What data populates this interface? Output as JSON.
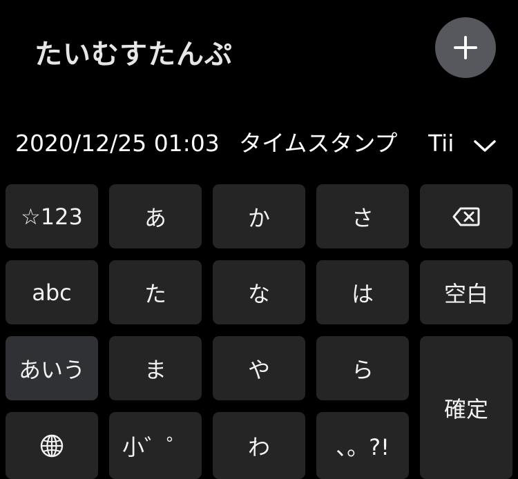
{
  "header": {
    "title": "たいむすたんぷ",
    "add_icon": "plus-icon"
  },
  "candidates": {
    "items": [
      {
        "label": "2020/12/25 01:03"
      },
      {
        "label": "タイムスタンプ"
      },
      {
        "label": "Tii"
      }
    ],
    "expand_icon": "chevron-down-icon"
  },
  "keyboard": {
    "rows": [
      {
        "keys": [
          {
            "label": "☆123"
          },
          {
            "label": "あ"
          },
          {
            "label": "か"
          },
          {
            "label": "さ"
          },
          {
            "label": "",
            "icon": "backspace-icon"
          }
        ]
      },
      {
        "keys": [
          {
            "label": "abc"
          },
          {
            "label": "た"
          },
          {
            "label": "な"
          },
          {
            "label": "は"
          },
          {
            "label": "空白"
          }
        ]
      },
      {
        "keys": [
          {
            "label": "あいう"
          },
          {
            "label": "ま"
          },
          {
            "label": "や"
          },
          {
            "label": "ら"
          },
          {
            "label": "確定"
          }
        ]
      },
      {
        "keys": [
          {
            "label": "",
            "icon": "globe-icon"
          },
          {
            "label": "小゛゜"
          },
          {
            "label": "わ"
          },
          {
            "label": "、。?!"
          }
        ]
      }
    ]
  },
  "colors": {
    "background": "#000000",
    "key": "#252525",
    "active_key": "#303134",
    "add_button": "#56585d",
    "text": "#ffffff"
  }
}
